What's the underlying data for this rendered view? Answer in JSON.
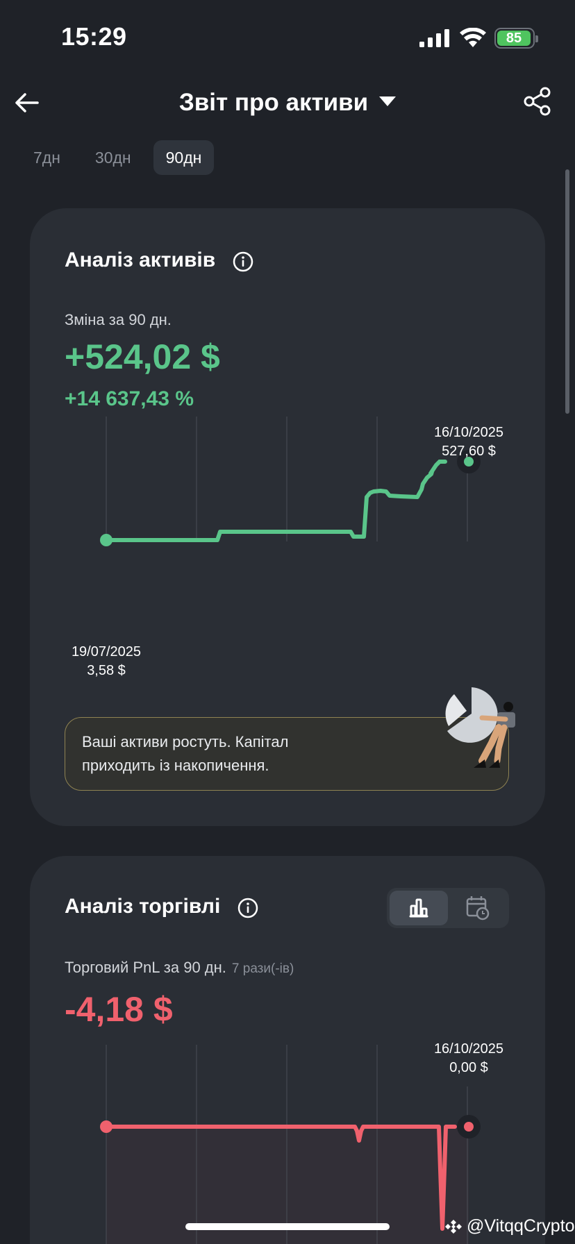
{
  "status_bar": {
    "time": "15:29",
    "battery": "85"
  },
  "nav": {
    "title": "Звіт про активи"
  },
  "period_tabs": [
    "7дн",
    "30дн",
    "90дн"
  ],
  "asset_analysis": {
    "title": "Аналіз активів",
    "change_label": "Зміна за 90 дн.",
    "change_value": "+524,02 $",
    "change_percent": "+14 637,43 %",
    "start_date": "19/07/2025",
    "start_value": "3,58 $",
    "end_date": "16/10/2025",
    "end_value": "527,60 $",
    "insight_text": "Ваші активи ростуть. Капітал приходить із накопичення."
  },
  "trading_analysis": {
    "title": "Аналіз торгівлі",
    "pnl_label": "Торговий PnL за 90 дн.",
    "trades_count": "7 рази(-ів)",
    "pnl_value": "-4,18 $",
    "end_date": "16/10/2025",
    "end_value": "0,00 $"
  },
  "watermark": "@VitqqCrypto",
  "colors": {
    "positive": "#5ac58a",
    "negative": "#f0616d",
    "card": "#2a2e35",
    "background": "#1f2228"
  },
  "chart_data": [
    {
      "type": "line",
      "series": [
        {
          "x": [
            "19/07/2025",
            "16/10/2025"
          ],
          "values": [
            3.58,
            527.6
          ]
        }
      ],
      "annotations": [
        {
          "x": "19/07/2025",
          "text": "3,58 $"
        },
        {
          "x": "16/10/2025",
          "text": "527,60 $"
        }
      ],
      "grid": true
    },
    {
      "type": "line",
      "series": [
        {
          "x": [
            "16/10/2025"
          ],
          "values": [
            0.0
          ]
        }
      ],
      "annotations": [
        {
          "x": "16/10/2025",
          "text": "0,00 $"
        }
      ],
      "grid": true
    }
  ]
}
